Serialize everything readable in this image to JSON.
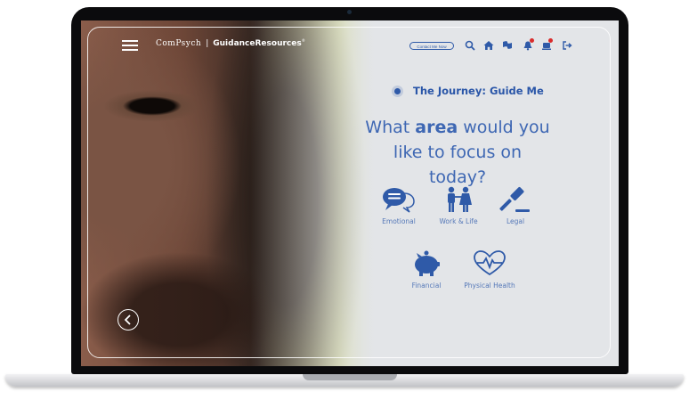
{
  "brand": {
    "company": "ComPsych",
    "product": "GuidanceResources",
    "separator": "|"
  },
  "nav": {
    "contact_label": "Contact Me Now",
    "icons": [
      "search-icon",
      "home-icon",
      "flag-icon",
      "bell-icon",
      "notifications-icon",
      "logout-icon"
    ]
  },
  "journey": {
    "title": "The Journey: Guide Me"
  },
  "question": {
    "before": "What ",
    "emphasis": "area",
    "after": " would you like to focus on today?"
  },
  "categories": [
    {
      "label": "Emotional",
      "icon": "speech-bubble-icon"
    },
    {
      "label": "Work & Life",
      "icon": "family-icon"
    },
    {
      "label": "Legal",
      "icon": "gavel-icon"
    },
    {
      "label": "Financial",
      "icon": "piggy-bank-icon"
    },
    {
      "label": "Physical Health",
      "icon": "heartbeat-icon"
    }
  ],
  "colors": {
    "accent": "#2f5aa8",
    "background": "#e3e5e8",
    "notification": "#d92b2b"
  }
}
